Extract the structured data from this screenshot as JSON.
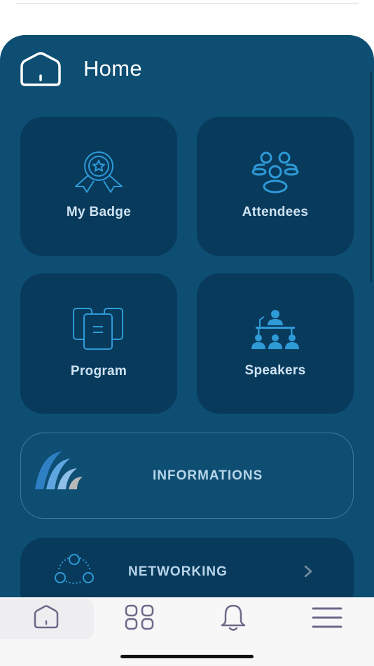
{
  "header": {
    "title": "Home",
    "icon": "home-icon"
  },
  "tiles": [
    {
      "label": "My Badge",
      "icon": "badge-icon"
    },
    {
      "label": "Attendees",
      "icon": "attendees-icon"
    },
    {
      "label": "Program",
      "icon": "program-icon"
    },
    {
      "label": "Speakers",
      "icon": "speakers-icon"
    }
  ],
  "informations": {
    "label": "INFORMATIONS",
    "icon": "app-logo"
  },
  "networking": {
    "label": "NETWORKING",
    "icon": "network-icon",
    "chevron": "chevron-right-icon"
  },
  "tabbar": {
    "items": [
      {
        "name": "home",
        "icon": "home-icon",
        "active": true
      },
      {
        "name": "apps",
        "icon": "grid-icon",
        "active": false
      },
      {
        "name": "notifications",
        "icon": "bell-icon",
        "active": false
      },
      {
        "name": "menu",
        "icon": "menu-icon",
        "active": false
      }
    ]
  },
  "colors": {
    "panel": "#0d4e72",
    "tile": "#083a5c",
    "icon_accent": "#2e9ad6",
    "tile_text": "#cfe3f2",
    "tab_icon": "#6b6a88"
  }
}
